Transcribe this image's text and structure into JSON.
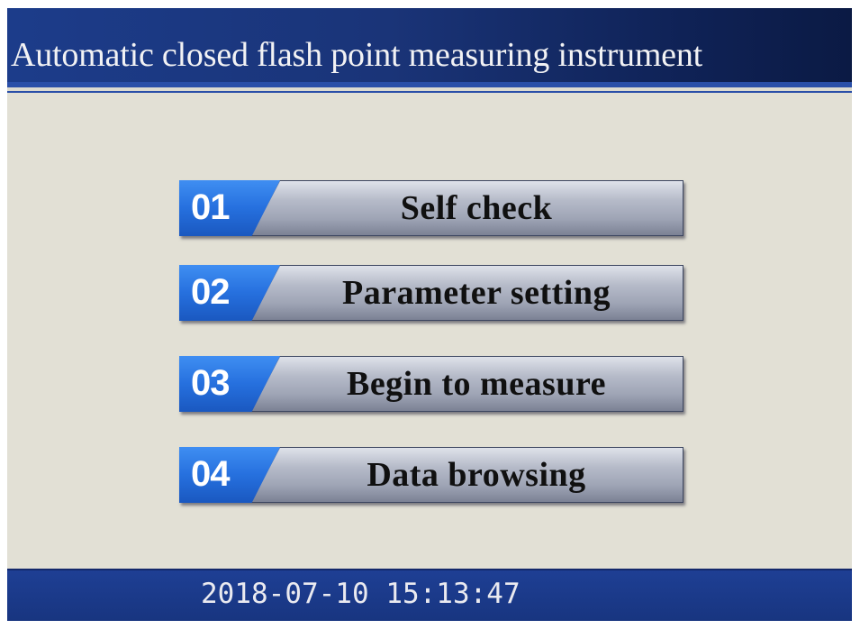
{
  "header": {
    "title": "Automatic closed flash point measuring instrument"
  },
  "menu": {
    "items": [
      {
        "number": "01",
        "label": "Self check"
      },
      {
        "number": "02",
        "label": "Parameter setting"
      },
      {
        "number": "03",
        "label": "Begin to measure"
      },
      {
        "number": "04",
        "label": "Data browsing"
      }
    ]
  },
  "status": {
    "date": "2018-07-10",
    "time": "15:13:47"
  },
  "colors": {
    "header_bg": "#1a3478",
    "tab_blue": "#2670de",
    "button_gray": "#b6bbc9",
    "screen_bg": "#e2e0d5",
    "status_bg": "#1e3f94"
  }
}
